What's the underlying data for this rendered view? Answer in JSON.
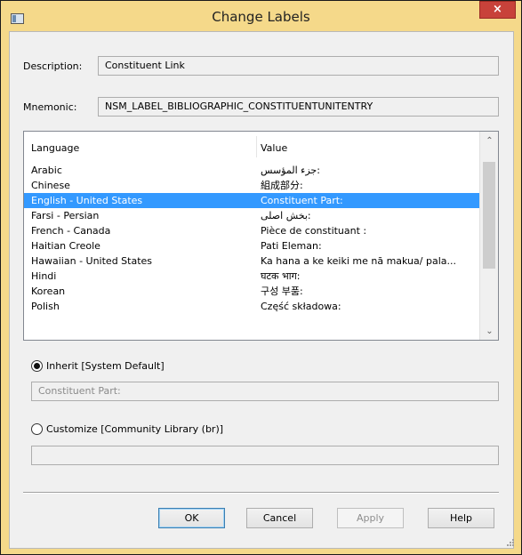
{
  "window": {
    "title": "Change Labels",
    "close_glyph": "×",
    "icons": [
      "app-window-icon",
      "close-icon",
      "chevron-up-icon",
      "chevron-down-icon",
      "size-grip-icon"
    ]
  },
  "fields": {
    "description_label": "Description:",
    "description_value": "Constituent Link",
    "mnemonic_label": "Mnemonic:",
    "mnemonic_value": "NSM_LABEL_BIBLIOGRAPHIC_CONSTITUENTUNITENTRY"
  },
  "list": {
    "columns": [
      "Language",
      "Value"
    ],
    "rows": [
      {
        "language": "Arabic",
        "value": "جزء المؤسس:"
      },
      {
        "language": "Chinese",
        "value": "組成部分:"
      },
      {
        "language": "English - United States",
        "value": "Constituent Part:"
      },
      {
        "language": "Farsi - Persian",
        "value": "بخش اصلی:"
      },
      {
        "language": "French - Canada",
        "value": "Pièce de constituant :"
      },
      {
        "language": "Haitian Creole",
        "value": "Pati Eleman:"
      },
      {
        "language": "Hawaiian - United States",
        "value": "Ka hana a ke keiki me nā makua/ pala..."
      },
      {
        "language": "Hindi",
        "value": "घटक भाग:"
      },
      {
        "language": "Korean",
        "value": "구성 부품:"
      },
      {
        "language": "Polish",
        "value": "Część składowa:"
      }
    ],
    "selected_index": 2
  },
  "options": {
    "inherit_label": "Inherit [System Default]",
    "inherit_value": "Constituent Part:",
    "inherit_selected": true,
    "customize_label": "Customize [Community Library  (br)]",
    "customize_value": "",
    "customize_selected": false
  },
  "buttons": {
    "ok": "OK",
    "cancel": "Cancel",
    "apply": "Apply",
    "help": "Help"
  },
  "colors": {
    "titlebar": "#f5d98a",
    "selection": "#3399ff",
    "close": "#c8423a"
  }
}
